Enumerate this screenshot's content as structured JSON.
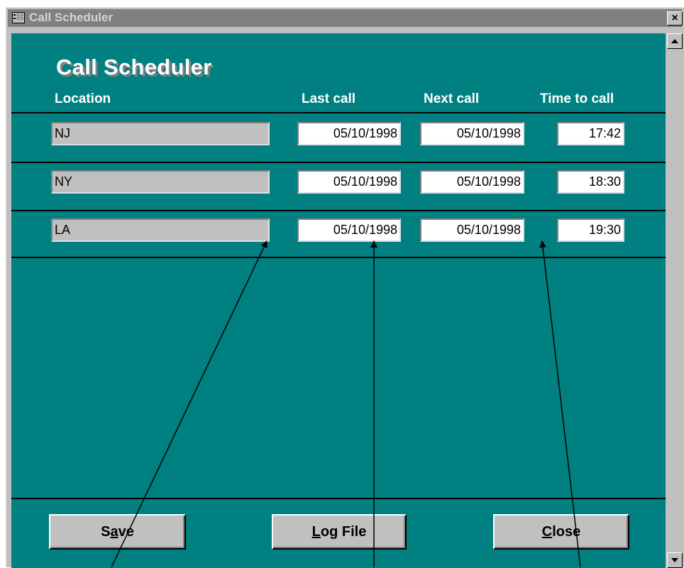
{
  "window": {
    "title": "Call Scheduler",
    "close_glyph": "×"
  },
  "form": {
    "title": "Call Scheduler",
    "headers": {
      "location": "Location",
      "last_call": "Last call",
      "next_call": "Next call",
      "time_to_call": "Time to call"
    },
    "rows": [
      {
        "location": "NJ",
        "last_call": "05/10/1998",
        "next_call": "05/10/1998",
        "time_to_call": "17:42"
      },
      {
        "location": "NY",
        "last_call": "05/10/1998",
        "next_call": "05/10/1998",
        "time_to_call": "18:30"
      },
      {
        "location": "LA",
        "last_call": "05/10/1998",
        "next_call": "05/10/1998",
        "time_to_call": "19:30"
      }
    ]
  },
  "buttons": {
    "save": {
      "pre": "S",
      "accel": "a",
      "post": "ve"
    },
    "log_file": {
      "pre": "",
      "accel": "L",
      "post": "og File"
    },
    "close": {
      "pre": "",
      "accel": "C",
      "post": "lose"
    }
  },
  "colors": {
    "form_background": "#008080",
    "titlebar": "#808080",
    "control_face": "#c0c0c0"
  },
  "icons": [
    "form-icon",
    "close-icon",
    "scroll-up-icon",
    "scroll-down-icon"
  ]
}
